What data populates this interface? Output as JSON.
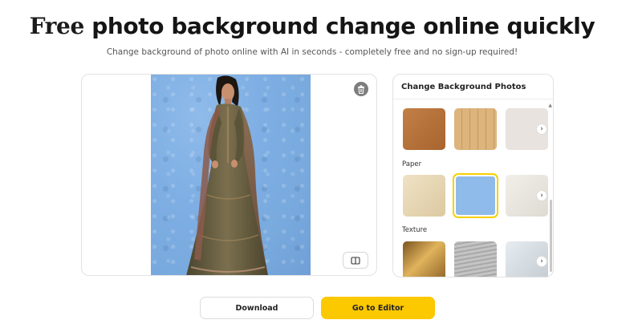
{
  "hero": {
    "title_highlight": "Free",
    "title_rest": " photo background change online quickly",
    "subtitle": "Change background of photo online with AI in seconds - completely free and no sign-up required!"
  },
  "preview": {
    "delete_icon": "trash-icon",
    "compare_icon": "compare-split-icon",
    "background_color": "#7eaee3"
  },
  "bg_panel": {
    "title": "Change Background Photos",
    "sections": [
      {
        "label": "",
        "thumbs": [
          {
            "name": "wood-dark",
            "color": "#b9743f"
          },
          {
            "name": "wood-light",
            "color": "#d9ad74"
          },
          {
            "name": "plain-light",
            "color": "#e8e3de"
          }
        ]
      },
      {
        "label": "Paper",
        "thumbs": [
          {
            "name": "paper-cream",
            "color": "#eadcbc"
          },
          {
            "name": "paper-blue",
            "color": "#8fbbea",
            "selected": true
          },
          {
            "name": "paper-white",
            "color": "#ece9e2"
          }
        ]
      },
      {
        "label": "Texture",
        "thumbs": [
          {
            "name": "texture-gold",
            "color": "#c89a48"
          },
          {
            "name": "texture-silver",
            "color": "#b9b9b9"
          },
          {
            "name": "texture-fabric",
            "color": "#d6dde2"
          }
        ]
      }
    ],
    "next_icon": "chevron-right-icon"
  },
  "actions": {
    "download_label": "Download",
    "editor_label": "Go to Editor"
  },
  "colors": {
    "accent": "#fcc800",
    "highlight": "#f6e34a"
  }
}
